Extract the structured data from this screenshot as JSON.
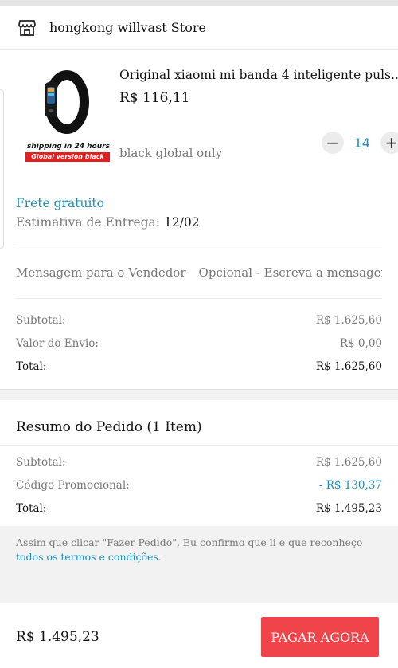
{
  "store": {
    "name": "hongkong willvast Store",
    "icon": "store-icon"
  },
  "product": {
    "title": "Original xiaomi mi banda 4 inteligente puls...",
    "price": "R$ 116,11",
    "variant": "black global only",
    "quantity": "14",
    "image_badge_text": "shipping in 24 hours",
    "image_badge_red": "Global version black",
    "decrement_label": "−",
    "increment_label": "+"
  },
  "shipping": {
    "free_label": "Frete gratuito",
    "estimate_label": "Estimativa de Entrega:",
    "estimate_date": "12/02"
  },
  "message": {
    "label": "Mensagem para o Vendedor",
    "placeholder": "Opcional - Escreva a mensagem"
  },
  "store_totals": {
    "subtotal_label": "Subtotal:",
    "subtotal_value": "R$ 1.625,60",
    "shipping_label": "Valor do Envio:",
    "shipping_value": "R$ 0,00",
    "total_label": "Total:",
    "total_value": "R$ 1.625,60"
  },
  "summary": {
    "title": "Resumo do Pedido (1 Item)",
    "subtotal_label": "Subtotal:",
    "subtotal_value": "R$ 1.625,60",
    "promo_label": "Código Promocional:",
    "promo_value": "- R$ 130,37",
    "total_label": "Total:",
    "total_value": "R$ 1.495,23"
  },
  "terms": {
    "text": "Assim que clicar \"Fazer Pedido\", Eu confirmo que li e que reconheço",
    "link": "todos os termos e condições",
    "suffix": "."
  },
  "footer": {
    "total": "R$ 1.495,23",
    "pay_button": "PAGAR AGORA"
  },
  "colors": {
    "accent": "#1a8fb8",
    "pay_button": "#f0434a"
  }
}
